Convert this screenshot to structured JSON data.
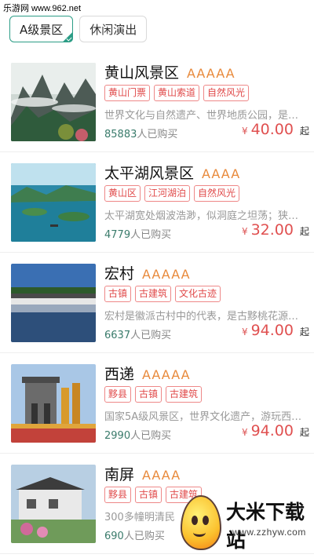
{
  "watermark_top": "乐游网 www.962.net",
  "tabs": [
    {
      "label": "A级景区",
      "active": true
    },
    {
      "label": "休闲演出",
      "active": false
    }
  ],
  "items": [
    {
      "name": "黄山风景区",
      "grade": "AAAAA",
      "tags": [
        "黄山门票",
        "黄山索道",
        "自然风光"
      ],
      "desc": "世界文化与自然遗产、世界地质公园，是国...",
      "sold_count": "85883",
      "sold_unit": "人已购买",
      "currency": "¥",
      "price": "40.00",
      "price_suffix": "起"
    },
    {
      "name": "太平湖风景区",
      "grade": "AAAA",
      "tags": [
        "黄山区",
        "江河湖泊",
        "自然风光"
      ],
      "desc": "太平湖宽处烟波浩渺，似洞庭之坦荡；狭处...",
      "sold_count": "4779",
      "sold_unit": "人已购买",
      "currency": "¥",
      "price": "32.00",
      "price_suffix": "起"
    },
    {
      "name": "宏村",
      "grade": "AAAAA",
      "tags": [
        "古镇",
        "古建筑",
        "文化古迹"
      ],
      "desc": "宏村是徽派古村中的代表，是古黟桃花源里...",
      "sold_count": "6637",
      "sold_unit": "人已购买",
      "currency": "¥",
      "price": "94.00",
      "price_suffix": "起"
    },
    {
      "name": "西递",
      "grade": "AAAAA",
      "tags": [
        "黟县",
        "古镇",
        "古建筑"
      ],
      "desc": "国家5A级风景区，世界文化遗产，游玩西递...",
      "sold_count": "2990",
      "sold_unit": "人已购买",
      "currency": "¥",
      "price": "94.00",
      "price_suffix": "起"
    },
    {
      "name": "南屏",
      "grade": "AAAA",
      "tags": [
        "黟县",
        "古镇",
        "古建筑"
      ],
      "desc": "300多幢明清民",
      "sold_count": "690",
      "sold_unit": "人已购买",
      "currency": "",
      "price": "",
      "price_suffix": ""
    }
  ],
  "logo": {
    "brand": "大米下载站",
    "url": "www.zzhyw.com"
  }
}
